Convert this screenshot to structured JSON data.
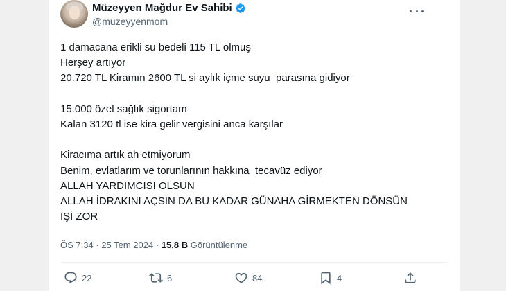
{
  "author": {
    "name": "Müzeyyen Mağdur Ev Sahibi",
    "handle": "@muzeyyenmom",
    "verified": true
  },
  "tweet": {
    "lines": [
      "1 damacana erikli su bedeli 115 TL olmuş",
      "Herşey artıyor",
      "20.720 TL Kiramın 2600 TL si aylık içme suyu  parasına gidiyor",
      "",
      "15.000 özel sağlık sigortam",
      "Kalan 3120 tl ise kira gelir vergisini anca karşılar",
      "",
      "Kiracıma artık ah etmiyorum",
      "Benim, evlatlarım ve torunlarının hakkına  tecavüz ediyor",
      "ALLAH YARDIMCISI OLSUN",
      "ALLAH İDRAKINI AÇSIN DA BU KADAR GÜNAHA GİRMEKTEN DÖNSÜN",
      "İŞİ ZOR"
    ]
  },
  "meta": {
    "time": "ÖS 7:34",
    "date": "25 Tem 2024",
    "separator": "·",
    "views_count": "15,8 B",
    "views_label": "Görüntülenme"
  },
  "actions": {
    "replies": "22",
    "retweets": "6",
    "likes": "84",
    "bookmarks": "4"
  },
  "colors": {
    "text": "#0f1419",
    "secondary": "#536471",
    "verified": "#1d9bf0",
    "side_background": "#f0f0f0"
  }
}
